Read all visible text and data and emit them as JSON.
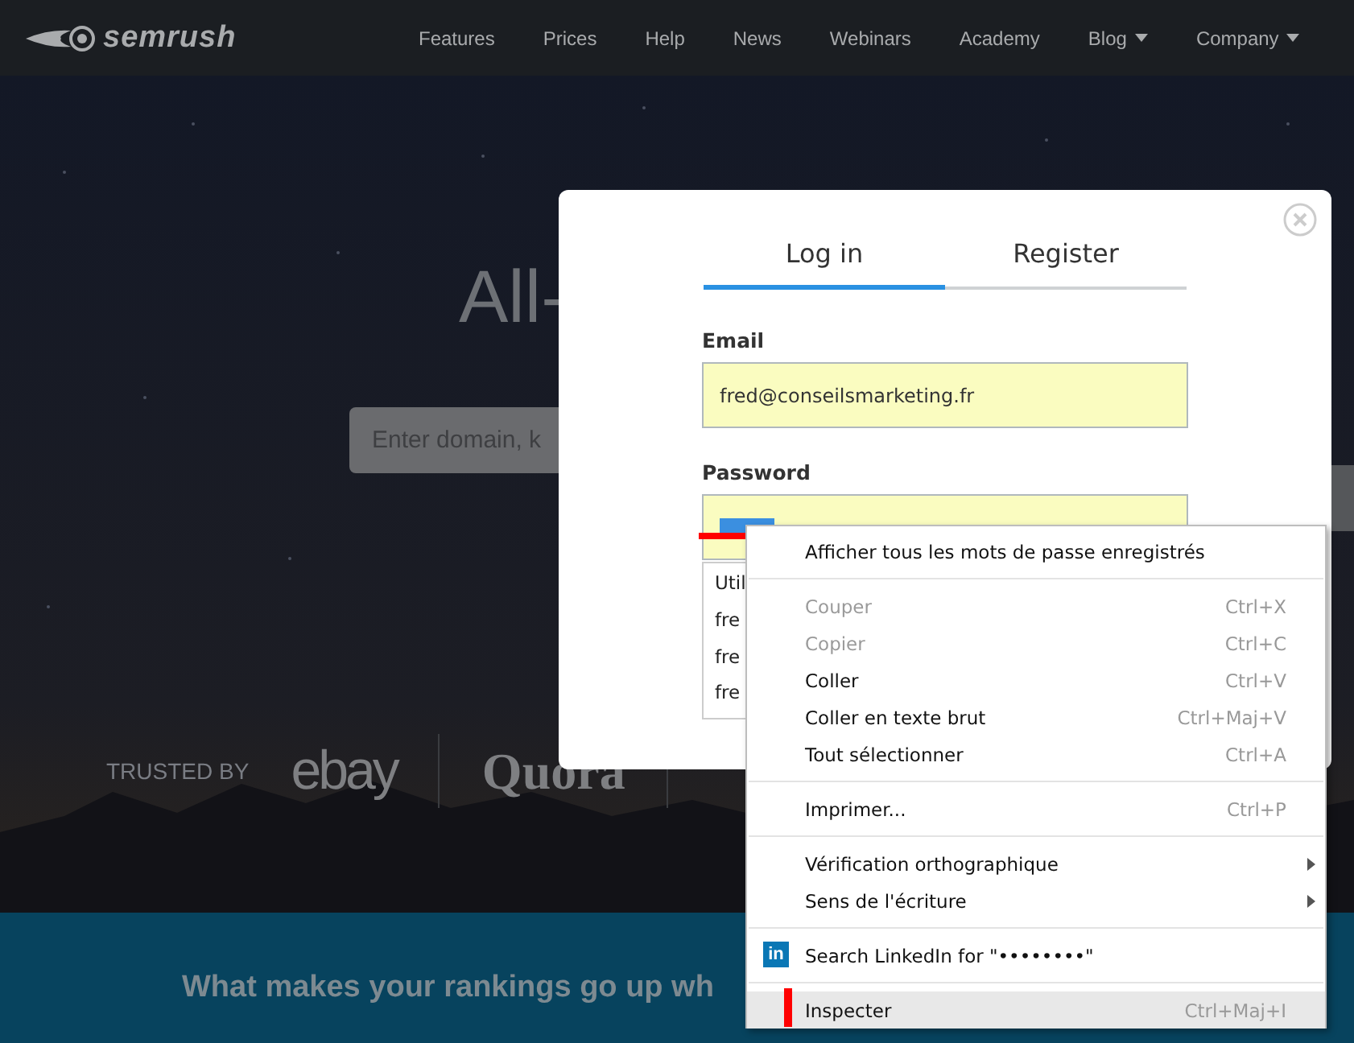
{
  "nav": {
    "logo": "semrush",
    "items": [
      {
        "label": "Features",
        "dropdown": false
      },
      {
        "label": "Prices",
        "dropdown": false
      },
      {
        "label": "Help",
        "dropdown": false
      },
      {
        "label": "News",
        "dropdown": false
      },
      {
        "label": "Webinars",
        "dropdown": false
      },
      {
        "label": "Academy",
        "dropdown": false
      },
      {
        "label": "Blog",
        "dropdown": true
      },
      {
        "label": "Company",
        "dropdown": true
      }
    ]
  },
  "hero": {
    "title": "All-",
    "search": {
      "placeholder": "Enter domain, k"
    },
    "trusted_label": "TRUSTED BY",
    "logos": [
      "ebay",
      "Quora"
    ]
  },
  "banner": {
    "heading": "What makes your rankings go up wh"
  },
  "modal": {
    "tabs": [
      {
        "label": "Log in",
        "selected": true
      },
      {
        "label": "Register",
        "selected": false
      }
    ],
    "email": {
      "label": "Email",
      "value": "fred@conseilsmarketing.fr"
    },
    "password": {
      "label": "Password"
    },
    "autofill": [
      "Util",
      "fre",
      "fre",
      "fre"
    ]
  },
  "context_menu": [
    {
      "kind": "item",
      "label": "Afficher tous les mots de passe enregistrés",
      "disabled": false,
      "selected": false,
      "submenu": false
    },
    {
      "kind": "separator"
    },
    {
      "kind": "item",
      "label": "Couper",
      "shortcut": "Ctrl+X",
      "disabled": true,
      "selected": false,
      "submenu": false
    },
    {
      "kind": "item",
      "label": "Copier",
      "shortcut": "Ctrl+C",
      "disabled": true,
      "selected": false,
      "submenu": false
    },
    {
      "kind": "item",
      "label": "Coller",
      "shortcut": "Ctrl+V",
      "disabled": false,
      "selected": false,
      "submenu": false
    },
    {
      "kind": "item",
      "label": "Coller en texte brut",
      "shortcut": "Ctrl+Maj+V",
      "disabled": false,
      "selected": false,
      "submenu": false
    },
    {
      "kind": "item",
      "label": "Tout sélectionner",
      "shortcut": "Ctrl+A",
      "disabled": false,
      "selected": false,
      "submenu": false
    },
    {
      "kind": "separator"
    },
    {
      "kind": "item",
      "label": "Imprimer...",
      "shortcut": "Ctrl+P",
      "disabled": false,
      "selected": false,
      "submenu": false
    },
    {
      "kind": "separator"
    },
    {
      "kind": "item",
      "label": "Vérification orthographique",
      "disabled": false,
      "selected": false,
      "submenu": true
    },
    {
      "kind": "item",
      "label": "Sens de l'écriture",
      "disabled": false,
      "selected": false,
      "submenu": true
    },
    {
      "kind": "separator"
    },
    {
      "kind": "item",
      "label": "Search LinkedIn for \"••••••••\"",
      "icon_text": "in",
      "disabled": false,
      "selected": false,
      "submenu": false
    },
    {
      "kind": "separator"
    },
    {
      "kind": "item",
      "label": "Inspecter",
      "shortcut": "Ctrl+Maj+I",
      "disabled": false,
      "selected": true,
      "submenu": false
    }
  ]
}
